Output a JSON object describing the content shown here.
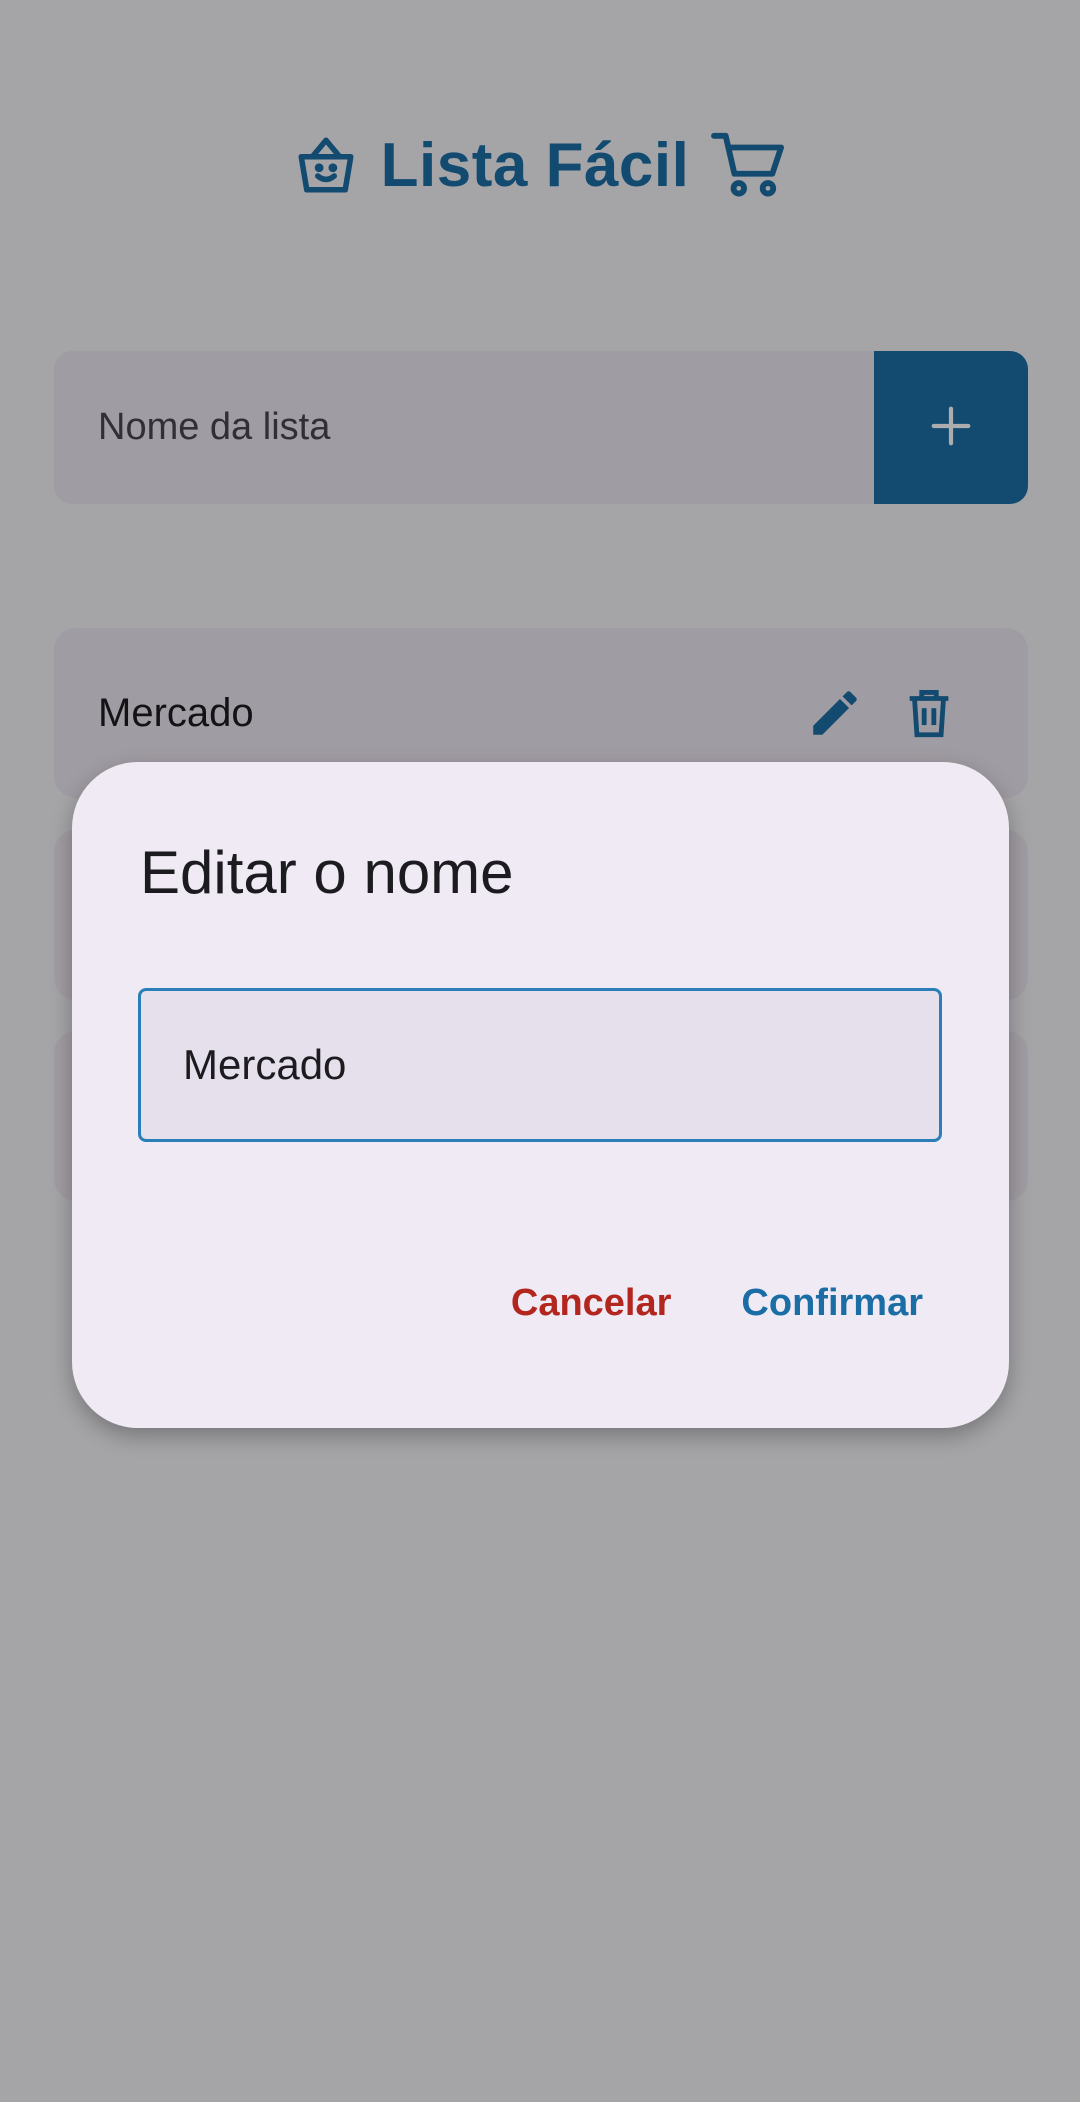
{
  "header": {
    "title": "Lista Fácil",
    "left_icon": "shopping-basket-icon",
    "right_icon": "shopping-cart-icon"
  },
  "add_list": {
    "placeholder": "Nome da lista",
    "add_icon": "plus-icon"
  },
  "lists": [
    {
      "name": "Mercado"
    },
    {
      "name": ""
    },
    {
      "name": ""
    }
  ],
  "dialog": {
    "title": "Editar o nome",
    "input_value": "Mercado",
    "cancel_label": "Cancelar",
    "confirm_label": "Confirmar"
  },
  "colors": {
    "primary": "#1b6da6",
    "danger": "#b3261e",
    "surface": "#ece6f0",
    "dialog_surface": "#efeaf4"
  }
}
